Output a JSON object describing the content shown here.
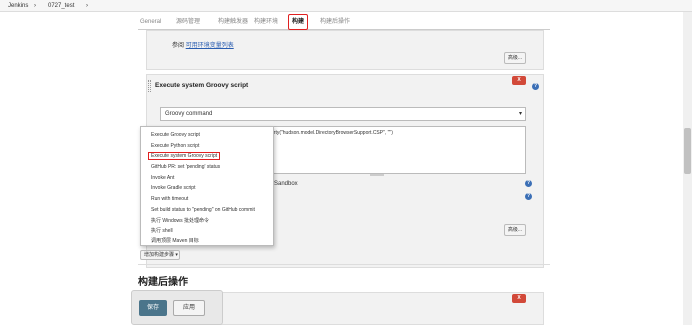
{
  "breadcrumb": {
    "root": "Jenkins",
    "sep1": "›",
    "job": "0727_test",
    "sep2": "›"
  },
  "tabs": [
    "General",
    "源码管理",
    "构建触发器",
    "构建环境",
    "构建",
    "构建后操作"
  ],
  "env": {
    "prefix": "参阅",
    "link": "可用环境变量列表",
    "advanced": "高级..."
  },
  "groovy": {
    "title": "Execute system Groovy script",
    "select": "Groovy command",
    "code_frag": "erty(\"hudson.model.DirectoryBrowserSupport.CSP\", \"\")",
    "sandbox": "Sandbox",
    "x": "X",
    "help": "?"
  },
  "menu": [
    "Execute Groovy script",
    "Execute Python script",
    "Execute system Groovy script",
    "GitHub PR: set 'pending' status",
    "Invoke Ant",
    "Invoke Gradle script",
    "Run with timeout",
    "Set build status to \"pending\" on GitHub commit",
    "执行 Windows 批处理命令",
    "执行 shell",
    "调用顶层 Maven 目标"
  ],
  "advanced2": "高级...",
  "add_step": "增加构建步骤 ▾",
  "post_title": "构建后操作",
  "save": "保存",
  "apply": "应用"
}
